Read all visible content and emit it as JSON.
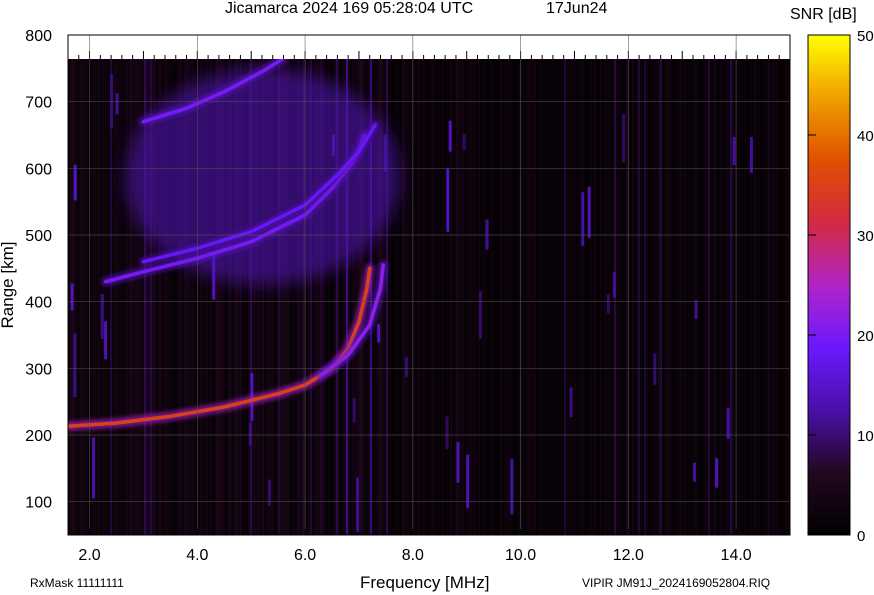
{
  "header": {
    "title": "Jicamarca 2024 169 05:28:04 UTC",
    "date": "17Jun24"
  },
  "footer": {
    "rxmask": "RxMask 11111111",
    "filename": "VIPIR  JM91J_2024169052804.RIQ"
  },
  "colorbar": {
    "label": "SNR [dB]",
    "min": 0,
    "max": 50,
    "ticks": [
      "0",
      "10",
      "20",
      "30",
      "40",
      "50"
    ],
    "colormap": [
      "#000000",
      "#22081f",
      "#4a10a8",
      "#6b18ff",
      "#b324c8",
      "#d22a40",
      "#e05000",
      "#f0a000",
      "#ffff00"
    ]
  },
  "chart_data": {
    "type": "heatmap",
    "title": "Jicamarca 2024 169 05:28:04 UTC",
    "xlabel": "Frequency [MHz]",
    "ylabel": "Range [km]",
    "xlim": [
      1.6,
      15.0
    ],
    "ylim": [
      50,
      800
    ],
    "xticks": [
      "2.0",
      "4.0",
      "6.0",
      "8.0",
      "10.0",
      "12.0",
      "14.0"
    ],
    "yticks": [
      "100",
      "200",
      "300",
      "400",
      "500",
      "600",
      "700",
      "800"
    ],
    "grid": true,
    "zlabel": "SNR [dB]",
    "zlim": [
      0,
      50
    ],
    "data_ceiling_km": 765,
    "traces": [
      {
        "name": "E/F lower trace (o-mode)",
        "snr_db": 35,
        "points": [
          [
            1.6,
            213
          ],
          [
            2.5,
            218
          ],
          [
            3.5,
            228
          ],
          [
            4.5,
            242
          ],
          [
            5.5,
            262
          ],
          [
            6.0,
            275
          ],
          [
            6.5,
            300
          ],
          [
            6.8,
            330
          ],
          [
            7.0,
            370
          ],
          [
            7.15,
            420
          ],
          [
            7.2,
            450
          ]
        ]
      },
      {
        "name": "E/F lower trace (x-mode)",
        "snr_db": 22,
        "points": [
          [
            6.3,
            290
          ],
          [
            6.8,
            320
          ],
          [
            7.2,
            365
          ],
          [
            7.4,
            420
          ],
          [
            7.45,
            455
          ]
        ]
      },
      {
        "name": "F2 trace (o-mode)",
        "snr_db": 20,
        "points": [
          [
            2.3,
            430
          ],
          [
            3.0,
            445
          ],
          [
            4.0,
            465
          ],
          [
            5.0,
            490
          ],
          [
            6.0,
            530
          ],
          [
            6.5,
            570
          ],
          [
            6.9,
            610
          ],
          [
            7.1,
            650
          ]
        ]
      },
      {
        "name": "F2 trace (x-mode)",
        "snr_db": 18,
        "points": [
          [
            3.0,
            460
          ],
          [
            4.0,
            480
          ],
          [
            5.0,
            505
          ],
          [
            6.0,
            545
          ],
          [
            6.6,
            590
          ],
          [
            7.0,
            625
          ],
          [
            7.3,
            665
          ]
        ]
      },
      {
        "name": "Multiple-hop trace",
        "snr_db": 20,
        "points": [
          [
            3.0,
            670
          ],
          [
            3.8,
            690
          ],
          [
            4.5,
            715
          ],
          [
            5.2,
            745
          ],
          [
            5.6,
            765
          ]
        ]
      }
    ],
    "diffuse_regions": [
      {
        "name": "spread-F",
        "snr_db": 14,
        "x": [
          2.3,
          7.4
        ],
        "y": [
          440,
          765
        ]
      }
    ]
  }
}
